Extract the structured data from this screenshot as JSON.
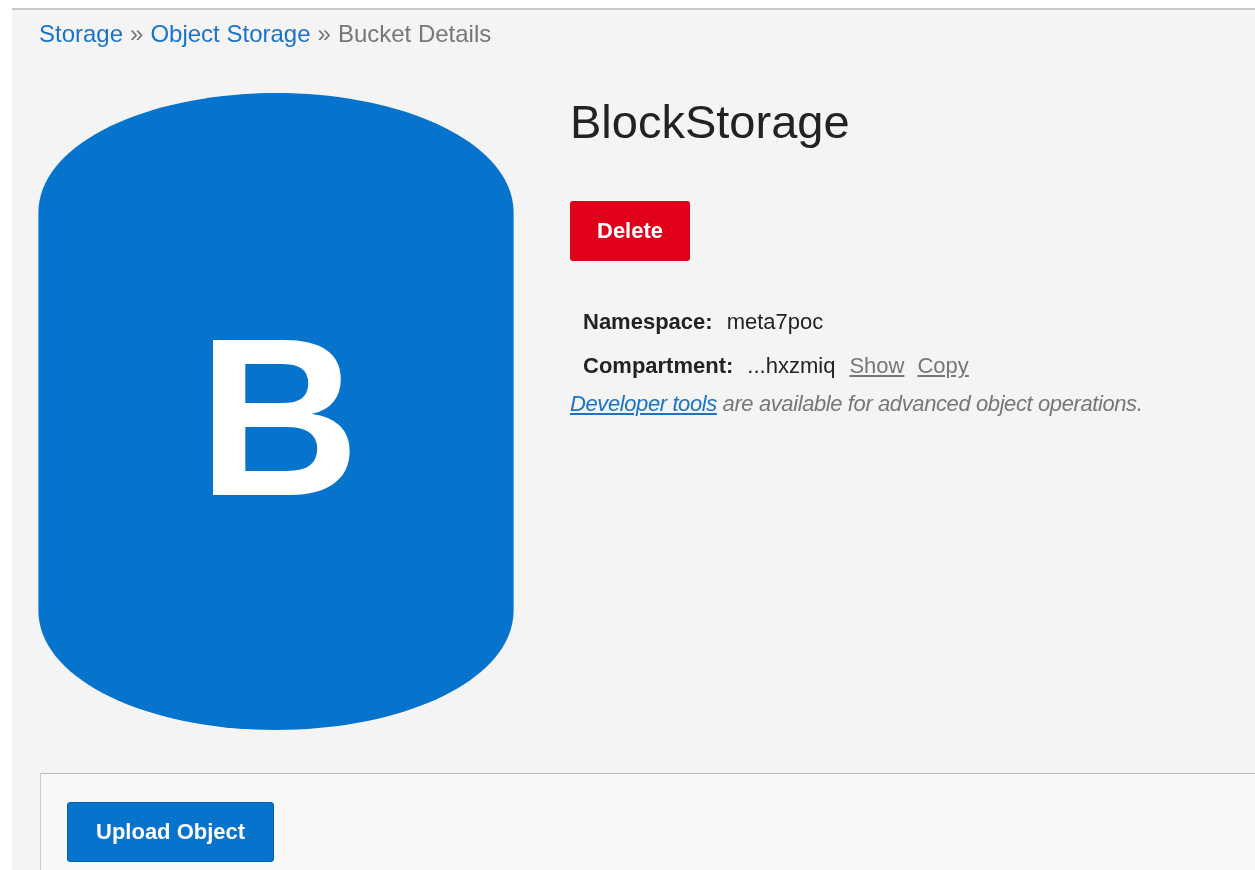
{
  "breadcrumb": [
    {
      "label": "Storage",
      "kind": "link"
    },
    {
      "label": "Object Storage",
      "kind": "link"
    },
    {
      "label": "Bucket Details",
      "kind": "current"
    }
  ],
  "breadcrumb_separator": "»",
  "bucket": {
    "letter": "B",
    "name": "BlockStorage"
  },
  "actions": [
    {
      "label": "Delete",
      "kind": "danger"
    }
  ],
  "details": [
    {
      "label": "Namespace:",
      "value": "meta7poc"
    },
    {
      "label": "Compartment:",
      "value": "...hxzmiq",
      "links": [
        "Show",
        "Copy"
      ]
    }
  ],
  "note": {
    "link": "Developer tools",
    "text": " are available for advanced object operations."
  },
  "objects_panel": {
    "buttons": [
      {
        "label": "Upload Object",
        "kind": "primary"
      }
    ]
  }
}
